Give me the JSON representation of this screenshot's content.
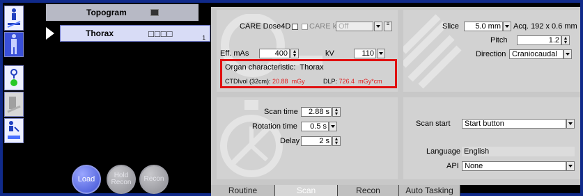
{
  "sidebar": {
    "icons": [
      {
        "name": "patient-table-icon",
        "selected": false
      },
      {
        "name": "patient-model-icon",
        "selected": true
      },
      {
        "name": "status-indicator-icon",
        "selected": false
      },
      {
        "name": "scanner-icon",
        "selected": false
      },
      {
        "name": "transfer-icon",
        "selected": false
      }
    ]
  },
  "tree": {
    "topogram_label": "Topogram",
    "series_label": "Thorax",
    "series_boxes": "□□□□",
    "series_number": "1"
  },
  "actions": {
    "load_label": "Load",
    "hold_recon_label_1": "Hold",
    "hold_recon_label_2": "Recon",
    "recon_label": "Recon"
  },
  "dose": {
    "care_dose_label": "CARE Dose4D",
    "care_kv_label": "CARE kV",
    "care_kv_value": "Off",
    "eff_mas_label": "Eff. mAs",
    "eff_mas_value": "400",
    "kv_label": "kV",
    "kv_value": "110",
    "organ_label": "Organ characteristic:",
    "organ_value": "Thorax",
    "ctdi_label": "CTDIvol (32cm):",
    "ctdi_value": "20.88",
    "ctdi_unit": "mGy",
    "dlp_label": "DLP:",
    "dlp_value": "726.4",
    "dlp_unit": "mGy*cm",
    "highlight_color": "#e01010"
  },
  "geometry": {
    "slice_label": "Slice",
    "slice_value": "5.0 mm",
    "acq_label": "Acq. 192 x 0.6 mm",
    "pitch_label": "Pitch",
    "pitch_value": "1.2",
    "direction_label": "Direction",
    "direction_value": "Craniocaudal"
  },
  "timing": {
    "scan_time_label": "Scan time",
    "scan_time_value": "2.88 s",
    "rotation_label": "Rotation time",
    "rotation_value": "0.5 s",
    "delay_label": "Delay",
    "delay_value": "2 s"
  },
  "start": {
    "scan_start_label": "Scan start",
    "scan_start_value": "Start button",
    "language_label": "Language",
    "language_value": "English",
    "api_label": "API",
    "api_value": "None"
  },
  "tabs": [
    {
      "label": "Routine",
      "active": false
    },
    {
      "label": "Scan",
      "active": true
    },
    {
      "label": "Recon",
      "active": false
    },
    {
      "label": "Auto Tasking",
      "active": false
    }
  ]
}
